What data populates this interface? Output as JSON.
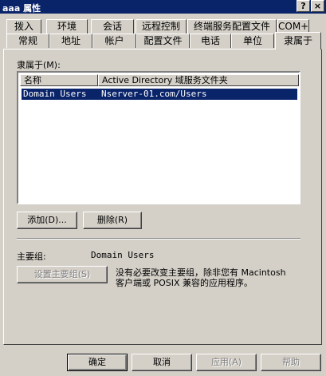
{
  "window": {
    "title": "aaa 属性",
    "help_glyph": "?",
    "close_glyph": "×"
  },
  "tabs_row1": [
    "拨入",
    "环境",
    "会话",
    "远程控制",
    "终端服务配置文件",
    "COM+"
  ],
  "tabs_row2": [
    "常规",
    "地址",
    "帐户",
    "配置文件",
    "电话",
    "单位",
    "隶属于"
  ],
  "member_of": {
    "label": "隶属于(M):",
    "columns": [
      "名称",
      "Active Directory 域服务文件夹"
    ],
    "rows": [
      {
        "name": "Domain Users",
        "folder": "Nserver-01.com/Users"
      }
    ]
  },
  "buttons": {
    "add": "添加(D)...",
    "remove": "删除(R)"
  },
  "primary_group": {
    "label": "主要组:",
    "value": "Domain Users",
    "set_button": "设置主要组(S)",
    "note_line1": "没有必要改变主要组，除非您有 Macintosh",
    "note_line2": "客户端或 POSIX 兼容的应用程序。"
  },
  "dialog_buttons": {
    "ok": "确定",
    "cancel": "取消",
    "apply": "应用(A)",
    "help": "帮助"
  }
}
